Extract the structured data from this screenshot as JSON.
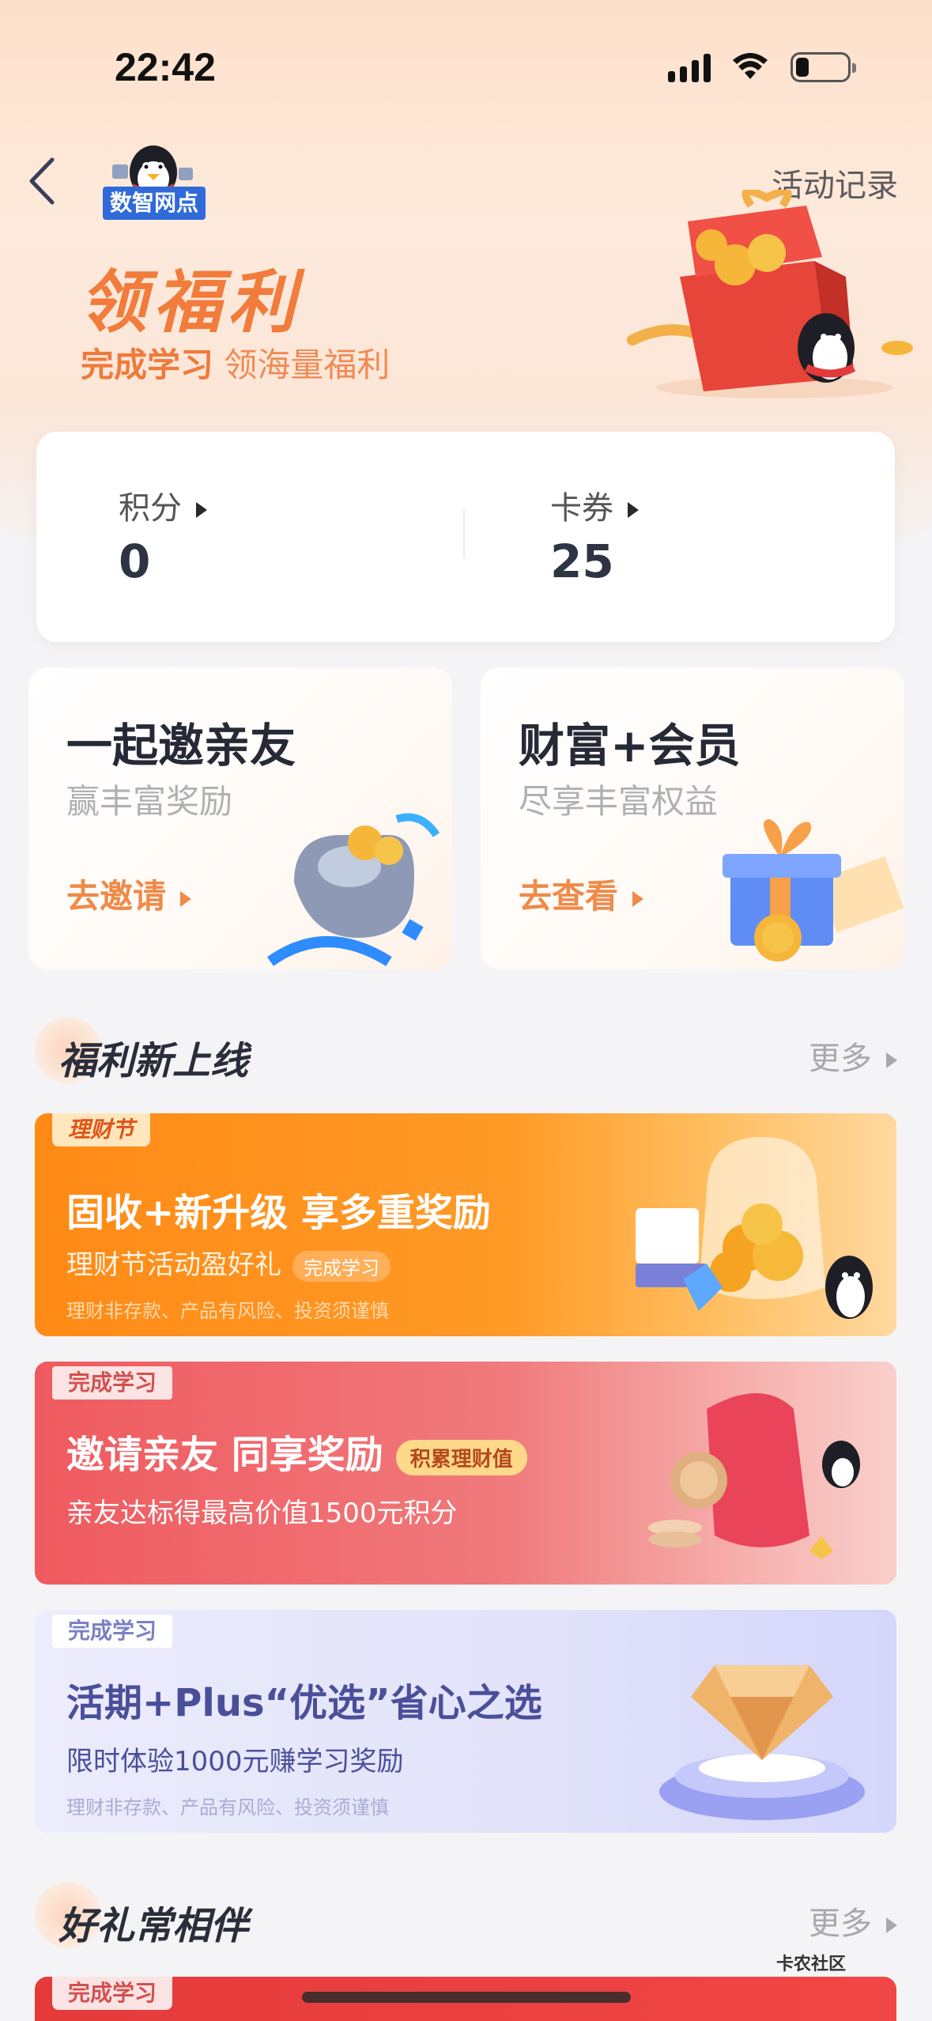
{
  "status_bar": {
    "time": "22:42"
  },
  "nav": {
    "brand": "数智网点",
    "activity_record": "活动记录"
  },
  "hero": {
    "title": "领福利",
    "subtitle_highlight": "完成学习",
    "subtitle_rest": " 领海量福利"
  },
  "points_card": {
    "points_label": "积分",
    "points_value": "0",
    "coupons_label": "卡券",
    "coupons_value": "25"
  },
  "features": [
    {
      "title": "一起邀亲友",
      "subtitle": "赢丰富奖励",
      "cta": "去邀请"
    },
    {
      "title": "财富+会员",
      "subtitle": "尽享丰富权益",
      "cta": "去查看"
    }
  ],
  "sections": {
    "new_welfare": {
      "title": "福利新上线",
      "more": "更多"
    },
    "gifts": {
      "title": "好礼常相伴",
      "more": "更多"
    }
  },
  "banners": [
    {
      "tag": "理财节",
      "title": "固收+新升级 享多重奖励",
      "desc": "理财节活动盈好礼",
      "pill": "完成学习",
      "fine": "理财非存款、产品有风险、投资须谨慎"
    },
    {
      "tag": "完成学习",
      "title": "邀请亲友 同享奖励",
      "badge": "积累理财值",
      "desc": "亲友达标得最高价值1500元积分"
    },
    {
      "tag": "完成学习",
      "title": "活期+Plus“优选”省心之选",
      "desc": "限时体验1000元赚学习奖励",
      "fine": "理财非存款、产品有风险、投资须谨慎"
    },
    {
      "tag": "完成学习"
    }
  ],
  "watermark": "卡农社区"
}
